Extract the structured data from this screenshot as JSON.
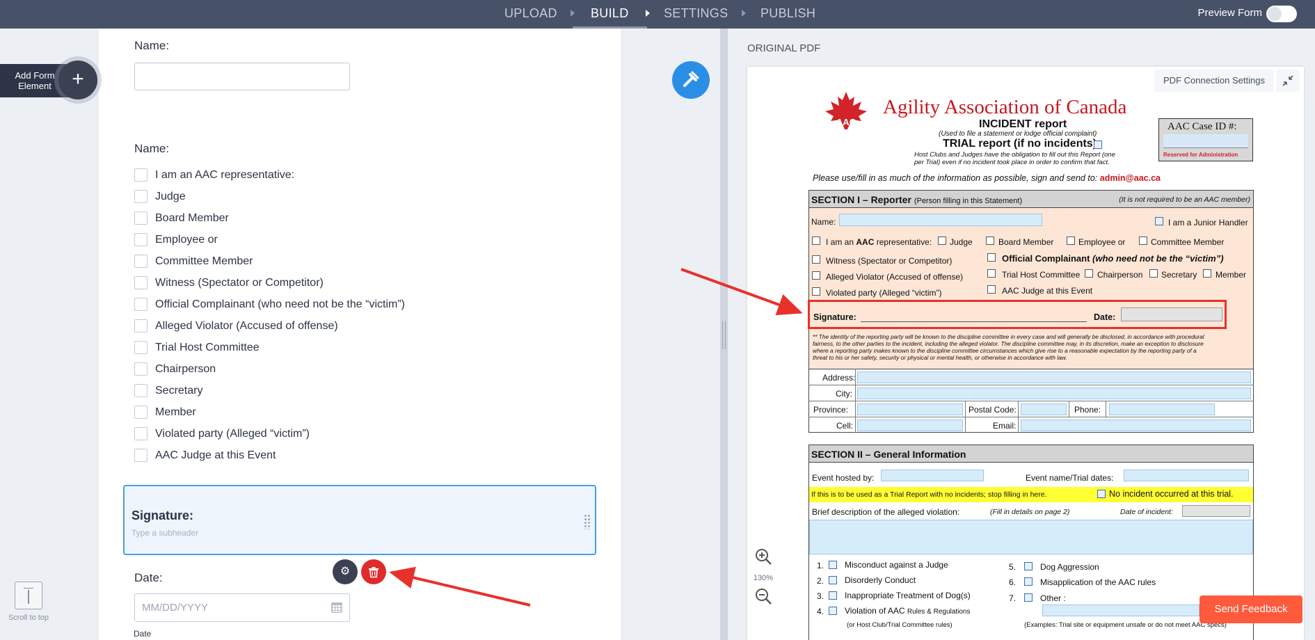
{
  "topbar": {
    "steps": [
      {
        "label": "UPLOAD",
        "active": false
      },
      {
        "label": "BUILD",
        "active": true
      },
      {
        "label": "SETTINGS",
        "active": false
      },
      {
        "label": "PUBLISH",
        "active": false
      }
    ],
    "preview_label": "Preview Form"
  },
  "sidebar": {
    "add_element_label": "Add Form Element",
    "scroll_top_label": "Scroll to top"
  },
  "form": {
    "name_label_1": "Name:",
    "name_label_2": "Name:",
    "checkbox_options": [
      "I am an AAC representative:",
      "Judge",
      "Board Member",
      "Employee or",
      "Committee Member",
      "Witness (Spectator or Competitor)",
      "Official Complainant (who need not be the “victim”)",
      "Alleged Violator (Accused of offense)",
      "Trial Host Committee",
      "Chairperson",
      "Secretary",
      "Member",
      "Violated party (Alleged “victim”)",
      "AAC Judge at this Event"
    ],
    "signature_title": "Signature:",
    "signature_subheader_placeholder": "Type a subheader",
    "date_label": "Date:",
    "date_placeholder": "MM/DD/YYYY",
    "date_sublabel": "Date"
  },
  "pdf_panel": {
    "title": "ORIGINAL PDF",
    "connection_settings": "PDF Connection Settings",
    "zoom_level": "130%",
    "document": {
      "org_name": "Agility Association of Canada",
      "logo_text": "AAC",
      "incident": "INCIDENT report",
      "used_to": "(Used to file a statement or lodge official complaint)",
      "trial": "TRIAL report (if no incidents)",
      "host_note_1": "Host Clubs and Judges have the obligation to fill out this Report (one",
      "host_note_2": "per Trial) even if no incident took place in order to confirm that fact.",
      "case_id": "AAC Case ID #:",
      "reserved": "Reserved for Administration",
      "send_to": "Please use/fill in as much of the information as possible, sign and send to:",
      "email": "admin@aac.ca",
      "section1": "SECTION I – Reporter",
      "section1_sub": "(Person filling in this Statement)",
      "section1_note": "(It is not required to be an AAC member)",
      "name": "Name:",
      "junior": "I am a Junior Handler",
      "rep_prefix": "I am an",
      "rep_bold": "AAC",
      "rep_suffix": "representative:",
      "judge": "Judge",
      "board": "Board Member",
      "employee": "Employee or",
      "committee": "Committee Member",
      "witness": "Witness (Spectator or Competitor)",
      "official": "Official Complainant",
      "official_note": "(who need not be the “victim”)",
      "violator": "Alleged Violator (Accused of offense)",
      "trial_host": "Trial Host Committee",
      "chair": "Chairperson",
      "secretary": "Secretary",
      "member": "Member",
      "violated": "Violated party (Alleged “victim”)",
      "aac_judge": "AAC Judge at this Event",
      "signature": "Signature:",
      "date": "Date:",
      "identity_1": "** The identity of the reporting party will be known to the discipline committee in every case and will generally be disclosed, in accordance with procedural",
      "identity_2": "fairness, to the other parties to the incident, including the alleged violator.  The discipline committee may, in its discretion, make an exception to disclosure",
      "identity_3": "where a reporting party makes known to the discipline committee circumstances which give rise to a reasonable expectation by the reporting party of a",
      "identity_4": "threat to his or her safety, security or physical or mental health, or otherwise in accordance with law.",
      "address": "Address:",
      "city": "City:",
      "province": "Province:",
      "postal": "Postal Code:",
      "phone": "Phone:",
      "cell": "Cell:",
      "email_label": "Email:",
      "section2": "SECTION II – General Information",
      "event_hosted": "Event hosted by:",
      "event_name": "Event name/Trial dates:",
      "trial_notice": "If this is to be used as a Trial Report with no incidents; stop filling in here.",
      "no_incident": "No incident occurred at this trial.",
      "brief": "Brief description of the alleged violation:",
      "fill_details": "(Fill in details on page 2)",
      "date_incident": "Date of incident:",
      "items_left": [
        {
          "num": "1.",
          "text": "Misconduct against a Judge"
        },
        {
          "num": "2.",
          "text": "Disorderly Conduct"
        },
        {
          "num": "3.",
          "text": "Inappropriate Treatment of Dog(s)"
        },
        {
          "num": "4.",
          "text": "Violation of AAC"
        }
      ],
      "rules_regs": "Rules & Regulations",
      "host_club_rules": "(or Host Club/Trial Committee rules)",
      "items_right": [
        {
          "num": "5.",
          "text": "Dog Aggression"
        },
        {
          "num": "6.",
          "text": "Misapplication of the AAC rules"
        },
        {
          "num": "7.",
          "text": "Other :"
        }
      ],
      "examples": "(Examples: Trial site or equipment unsafe or do not meet AAC specs)"
    }
  },
  "feedback_label": "Send Feedback",
  "colors": {
    "topbar": "#475168",
    "accent_blue": "#2b8ee5",
    "delete_red": "#e02b2b",
    "feedback": "#ff5a3c",
    "annotation_red": "#e8312a",
    "aac_red": "#c8171e"
  }
}
